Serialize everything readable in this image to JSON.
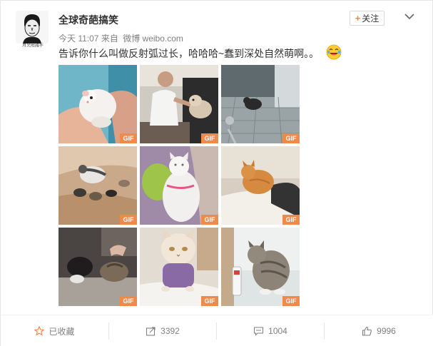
{
  "account": {
    "name": "全球奇葩搞笑",
    "avatar_signature": "月光照路手"
  },
  "post": {
    "time": "今天 11:07",
    "source_prefix": "来自",
    "source": "微博 weibo.com",
    "text": "告诉你什么叫做反射弧过长，哈哈哈~蠢到深处自然萌啊。。",
    "emoji": "laughing-tears-emoji"
  },
  "follow": {
    "label": "关注"
  },
  "images": [
    {
      "badge": "GIF",
      "subject": "hamster-in-hand"
    },
    {
      "badge": "GIF",
      "subject": "man-and-dog-on-couch"
    },
    {
      "badge": "GIF",
      "subject": "cat-on-tiled-floor"
    },
    {
      "badge": "GIF",
      "subject": "cat-and-kittens-on-blanket"
    },
    {
      "badge": "GIF",
      "subject": "white-cat-pink-collar"
    },
    {
      "badge": "GIF",
      "subject": "orange-cat-on-bed"
    },
    {
      "badge": "GIF",
      "subject": "cats-with-hand"
    },
    {
      "badge": "GIF",
      "subject": "persian-cat-in-sweater"
    },
    {
      "badge": "GIF",
      "subject": "cat-and-bottle"
    }
  ],
  "actions": {
    "favorite": "已收藏",
    "repost": "3392",
    "comment": "1004",
    "like": "9996"
  },
  "colors": {
    "accent": "#ff8140",
    "badge": "#f08a4b",
    "text": "#333333",
    "muted": "#808080"
  }
}
